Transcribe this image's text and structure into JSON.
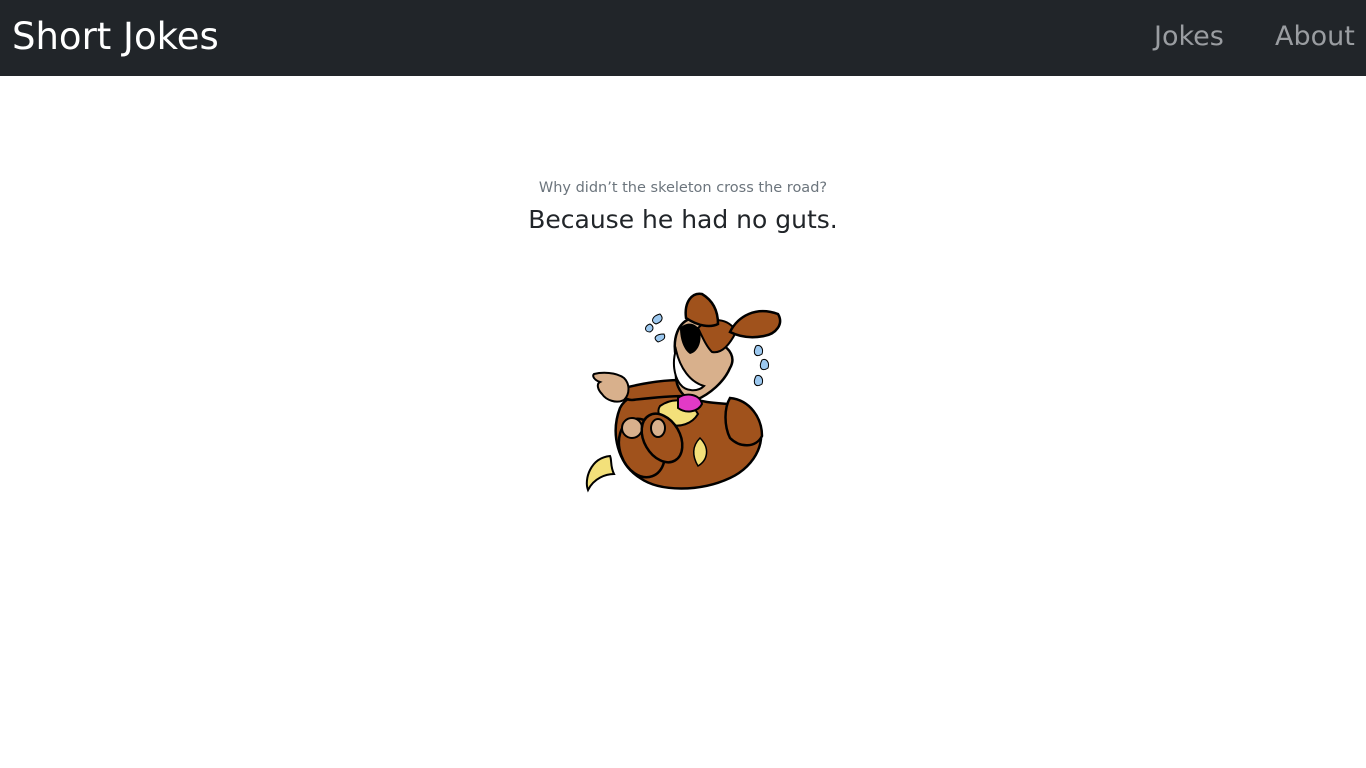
{
  "navbar": {
    "brand": "Short Jokes",
    "links": [
      {
        "label": "Jokes"
      },
      {
        "label": "About"
      }
    ],
    "background": "#212529",
    "link_color": "#9a9da1"
  },
  "joke": {
    "question": "Why didn’t the skeleton cross the road?",
    "answer": "Because he had no guts."
  },
  "illustration": {
    "icon": "laughing-dog-icon"
  }
}
